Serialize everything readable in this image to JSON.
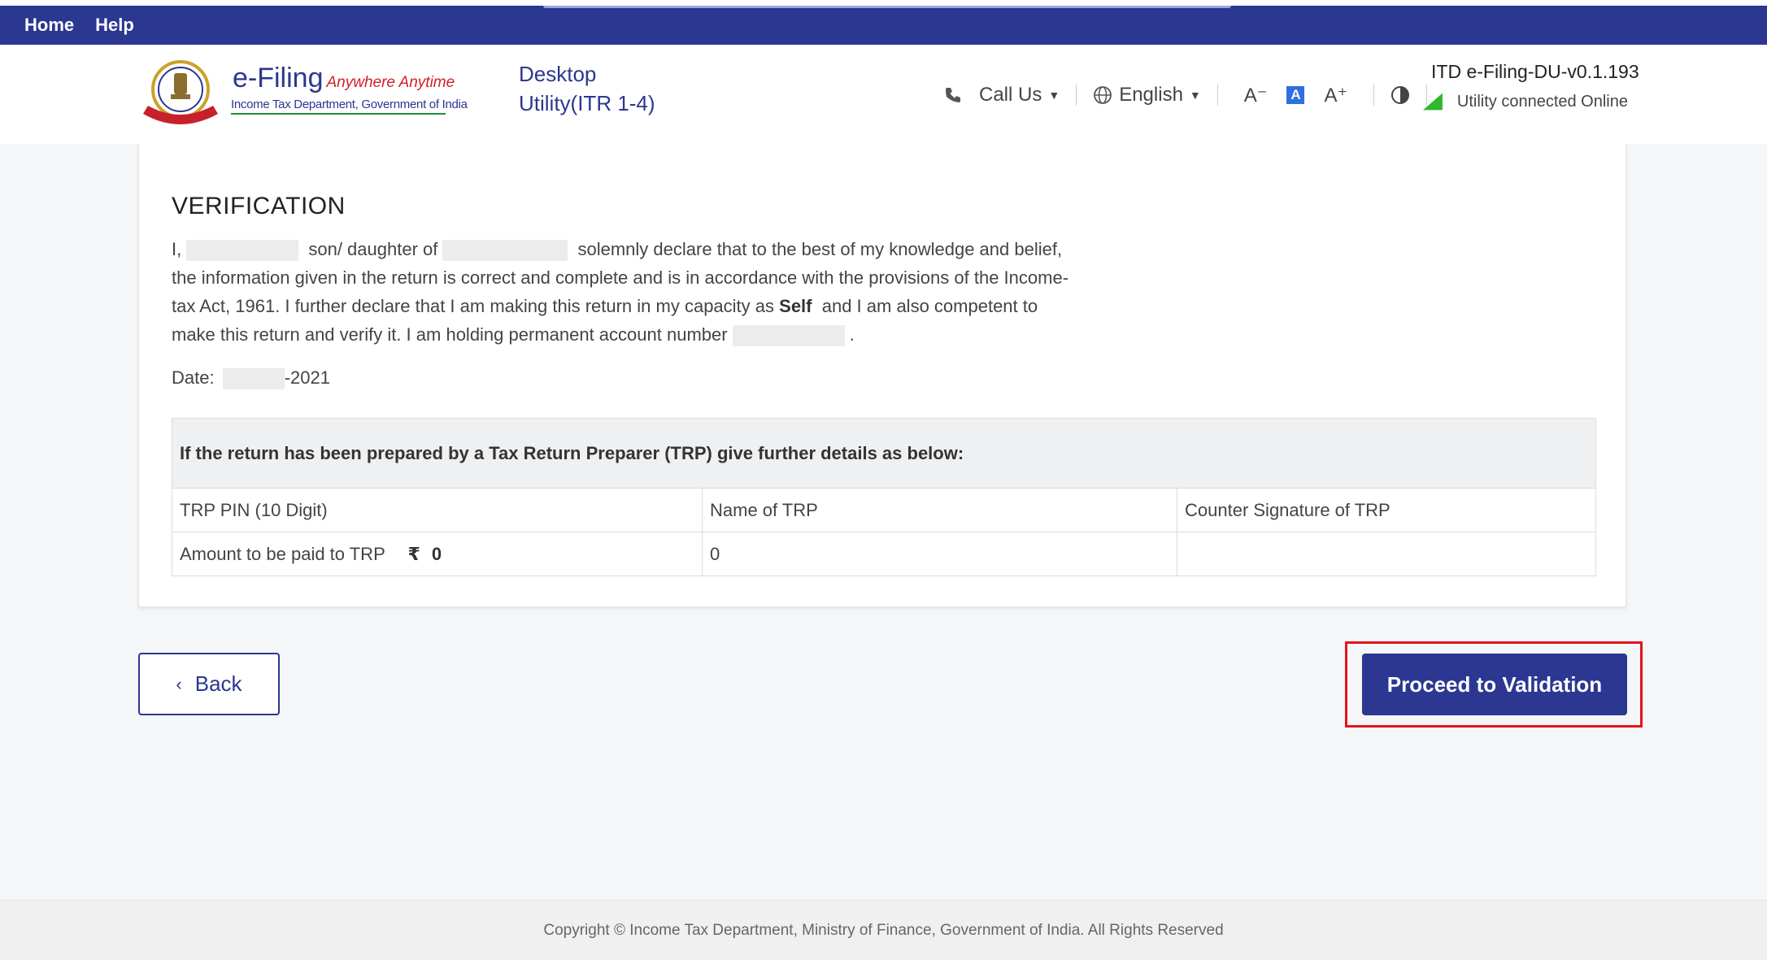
{
  "topnav": {
    "home": "Home",
    "help": "Help"
  },
  "logo": {
    "title": "e-Filing",
    "tagline": "Anywhere Anytime",
    "subtitle": "Income Tax Department, Government of India"
  },
  "app": {
    "title_line1": "Desktop",
    "title_line2": "Utility(ITR 1-4)"
  },
  "header_tools": {
    "call_us": "Call Us",
    "language": "English",
    "font_decrease": "A⁻",
    "font_default": "A",
    "font_increase": "A⁺"
  },
  "version": "ITD e-Filing-DU-v0.1.193",
  "connection_status": "Utility connected Online",
  "verification": {
    "title": "VERIFICATION",
    "prefix": "I,",
    "son_daughter": "son/ daughter of",
    "line1_end": "solemnly declare that to the best of my knowledge and belief,",
    "line2": "the information given in the return is correct and complete and is in accordance with the provisions of the Income-",
    "line3_start": "tax Act, 1961. I further declare that I am making this return in my capacity as",
    "capacity": "Self",
    "line3_end": "and I am also competent to",
    "line4": "make this return and verify it. I am holding permanent account number",
    "line4_end": ".",
    "date_label": "Date:",
    "date_suffix": "-2021"
  },
  "trp": {
    "heading": "If the return has been prepared by a Tax Return Preparer (TRP) give further details as below:",
    "pin_label": "TRP PIN (10 Digit)",
    "name_label": "Name of TRP",
    "signature_label": "Counter Signature of TRP",
    "amount_label": "Amount to be paid to TRP",
    "currency": "₹",
    "amount_value": "0",
    "name_value": "0"
  },
  "buttons": {
    "back": "Back",
    "proceed": "Proceed to Validation"
  },
  "footer": "Copyright © Income Tax Department, Ministry of Finance, Government of India. All Rights Reserved",
  "colors": {
    "primary": "#2b3791",
    "highlight": "#e4141b",
    "status_green": "#2eb82e"
  }
}
